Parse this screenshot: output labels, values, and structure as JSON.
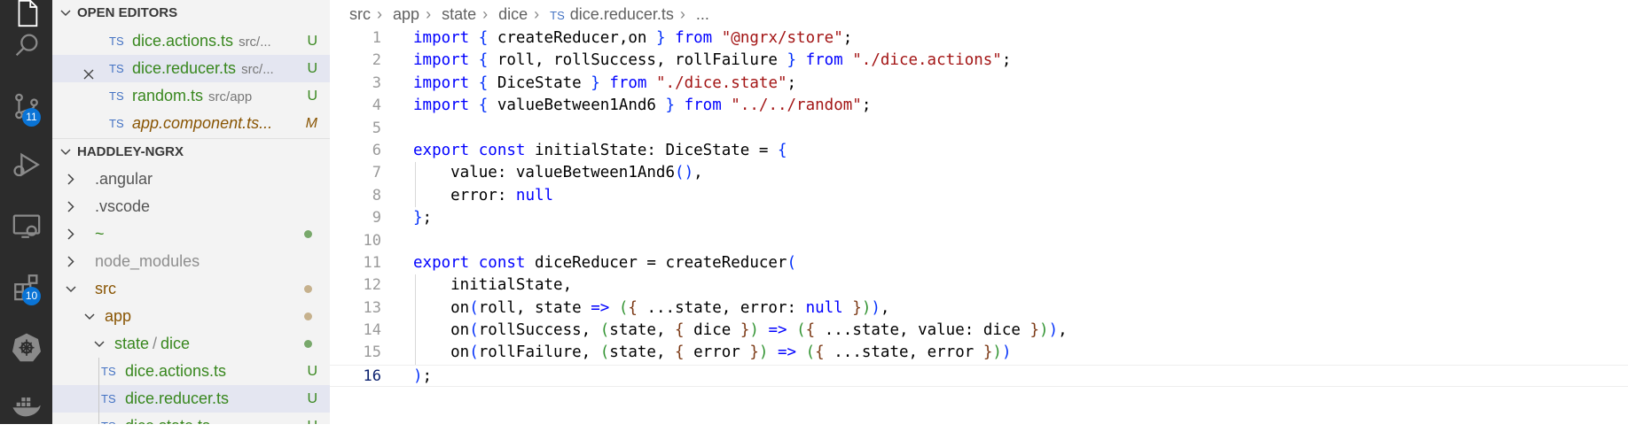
{
  "activity_bar": {
    "items": [
      {
        "name": "explorer-icon"
      },
      {
        "name": "search-icon"
      },
      {
        "name": "source-control-icon",
        "badge": "11"
      },
      {
        "name": "run-debug-icon"
      },
      {
        "name": "remote-explorer-icon"
      },
      {
        "name": "extensions-icon",
        "badge": "10"
      },
      {
        "name": "kubernetes-icon"
      },
      {
        "name": "docker-icon"
      }
    ]
  },
  "sidebar": {
    "open_editors": {
      "title": "OPEN EDITORS",
      "items": [
        {
          "type": "TS",
          "name": "dice.actions.ts",
          "path": "src/...",
          "status": "U"
        },
        {
          "type": "TS",
          "name": "dice.reducer.ts",
          "path": "src/...",
          "status": "U"
        },
        {
          "type": "TS",
          "name": "random.ts",
          "path": "src/app",
          "status": "U"
        },
        {
          "type": "TS",
          "name": "app.component.ts...",
          "path": "",
          "status": "M"
        }
      ]
    },
    "workspace": {
      "title": "HADDLEY-NGRX",
      "items": [
        {
          "label": ".angular"
        },
        {
          "label": ".vscode"
        },
        {
          "label": "~"
        },
        {
          "label": "node_modules"
        },
        {
          "label": "src"
        },
        {
          "label": "app"
        },
        {
          "label": "state"
        },
        {
          "label": "dice"
        },
        {
          "type": "TS",
          "label": "dice.actions.ts",
          "status": "U"
        },
        {
          "type": "TS",
          "label": "dice.reducer.ts",
          "status": "U"
        },
        {
          "type": "TS",
          "label": "dice.state.ts",
          "status": "U"
        }
      ]
    },
    "colors": {
      "untracked": "#38871e",
      "modified": "#895503",
      "selected_bg": "#e4e6f1"
    }
  },
  "editor": {
    "breadcrumb": [
      "src",
      "app",
      "state",
      "dice",
      "TS",
      "dice.reducer.ts",
      "..."
    ],
    "active_line": 16,
    "lines": [
      {
        "n": "1",
        "text": "import { createReducer,on } from \"@ngrx/store\";"
      },
      {
        "n": "2",
        "text": "import { roll, rollSuccess, rollFailure } from \"./dice.actions\";"
      },
      {
        "n": "3",
        "text": "import { DiceState } from \"./dice.state\";"
      },
      {
        "n": "4",
        "text": "import { valueBetween1And6 } from \"../../random\";"
      },
      {
        "n": "5",
        "text": ""
      },
      {
        "n": "6",
        "text": "export const initialState: DiceState = {"
      },
      {
        "n": "7",
        "text": "    value: valueBetween1And6(),"
      },
      {
        "n": "8",
        "text": "    error: null"
      },
      {
        "n": "9",
        "text": "};"
      },
      {
        "n": "10",
        "text": ""
      },
      {
        "n": "11",
        "text": "export const diceReducer = createReducer("
      },
      {
        "n": "12",
        "text": "    initialState,"
      },
      {
        "n": "13",
        "text": "    on(roll, state => ({ ...state, error: null })),"
      },
      {
        "n": "14",
        "text": "    on(rollSuccess, (state, { dice }) => ({ ...state, value: dice })),"
      },
      {
        "n": "15",
        "text": "    on(rollFailure, (state, { error }) => ({ ...state, error }))"
      },
      {
        "n": "16",
        "text": ");"
      }
    ]
  }
}
